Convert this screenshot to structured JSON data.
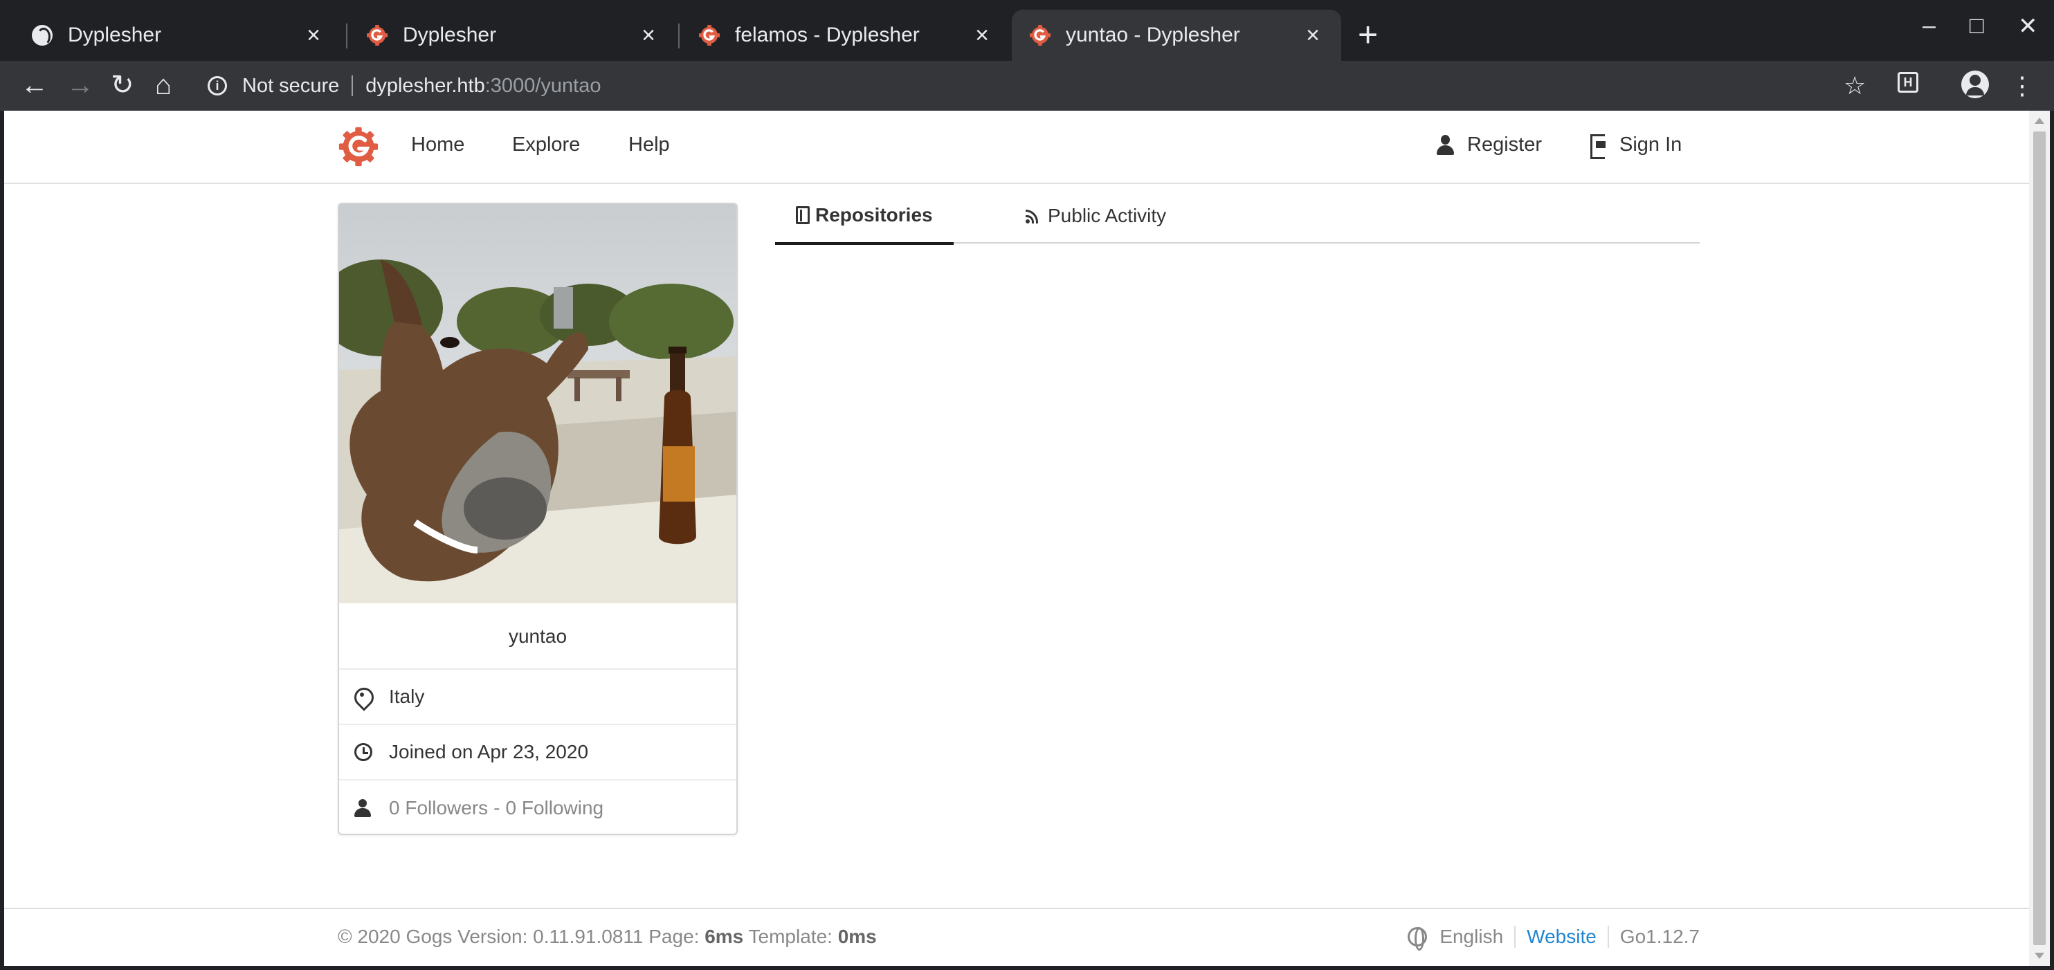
{
  "browser": {
    "tabs": [
      {
        "title": "Dyplesher",
        "active": false
      },
      {
        "title": "Dyplesher",
        "active": false
      },
      {
        "title": "felamos - Dyplesher",
        "active": false
      },
      {
        "title": "yuntao - Dyplesher",
        "active": true
      }
    ],
    "new_tab_label": "+",
    "security_label": "Not secure",
    "url_host": "dyplesher.htb",
    "url_path": ":3000/yuntao",
    "controls": {
      "minimize": "–",
      "maximize": "□",
      "close": "✕"
    }
  },
  "nav": {
    "home": "Home",
    "explore": "Explore",
    "help": "Help",
    "register": "Register",
    "sign_in": "Sign In"
  },
  "profile": {
    "username": "yuntao",
    "location": "Italy",
    "joined": "Joined on Apr 23, 2020",
    "followers": "0 Followers",
    "separator": "-",
    "following": "0 Following"
  },
  "tabs": {
    "repositories": "Repositories",
    "public_activity": "Public Activity"
  },
  "footer": {
    "copyright": "© 2020 Gogs Version: 0.11.91.0811 Page: ",
    "page_time": "6ms",
    "template_label": " Template: ",
    "template_time": "0ms",
    "language": "English",
    "website": "Website",
    "go_version": "Go1.12.7"
  },
  "colors": {
    "brand": "#e05d44",
    "link": "#2185d0",
    "chrome_bg": "#202124",
    "toolbar_bg": "#35363a"
  }
}
